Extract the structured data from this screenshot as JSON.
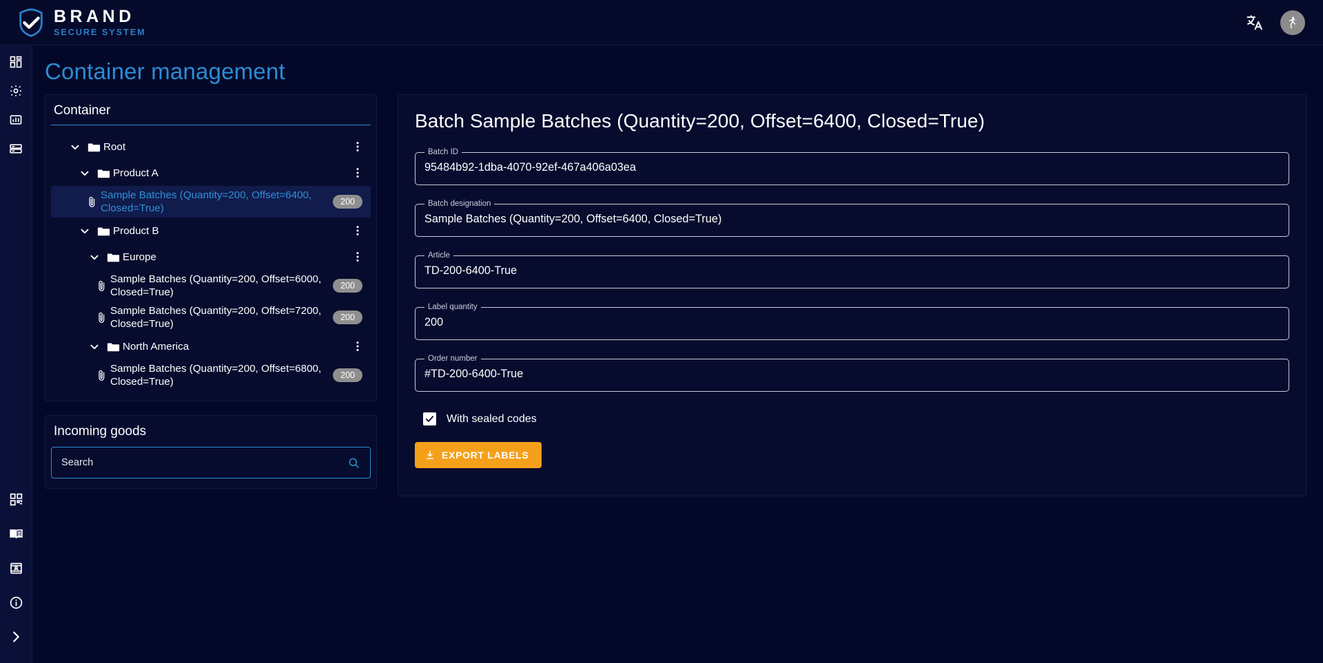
{
  "header": {
    "logo_brand": "BRAND",
    "logo_sub": "SECURE SYSTEM",
    "logo_icon": "shield-check-icon",
    "translate_icon": "translate-icon",
    "accessibility_icon": "accessibility-icon"
  },
  "rail": {
    "top_items": [
      {
        "name": "dashboard-icon",
        "label": "Dashboard"
      },
      {
        "name": "gear-icon",
        "label": "Settings"
      },
      {
        "name": "chart-icon",
        "label": "Reports"
      },
      {
        "name": "container-icon",
        "label": "Containers"
      }
    ],
    "bottom_items": [
      {
        "name": "qr-code-icon",
        "label": "Codes"
      },
      {
        "name": "book-icon",
        "label": "Manual"
      },
      {
        "name": "contact-card-icon",
        "label": "Contact"
      },
      {
        "name": "info-icon",
        "label": "Info"
      },
      {
        "name": "chevron-right-icon",
        "label": "Expand menu"
      }
    ]
  },
  "page": {
    "title": "Container management"
  },
  "container_panel": {
    "heading": "Container",
    "tree": [
      {
        "type": "folder",
        "label": "Root",
        "indent": 0,
        "expanded": true,
        "menu": true,
        "selected": false,
        "badge": null
      },
      {
        "type": "folder",
        "label": "Product A",
        "indent": 1,
        "expanded": true,
        "menu": true,
        "selected": false,
        "badge": null
      },
      {
        "type": "batch",
        "label": "Sample Batches (Quantity=200, Offset=6400, Closed=True)",
        "indent": 2,
        "expanded": false,
        "menu": false,
        "selected": true,
        "badge": "200"
      },
      {
        "type": "folder",
        "label": "Product B",
        "indent": 1,
        "expanded": true,
        "menu": true,
        "selected": false,
        "badge": null
      },
      {
        "type": "folder",
        "label": "Europe",
        "indent": 2,
        "expanded": true,
        "menu": true,
        "selected": false,
        "badge": null
      },
      {
        "type": "batch",
        "label": "Sample Batches (Quantity=200, Offset=6000, Closed=True)",
        "indent": 3,
        "expanded": false,
        "menu": false,
        "selected": false,
        "badge": "200"
      },
      {
        "type": "batch",
        "label": "Sample Batches (Quantity=200, Offset=7200, Closed=True)",
        "indent": 3,
        "expanded": false,
        "menu": false,
        "selected": false,
        "badge": "200"
      },
      {
        "type": "folder",
        "label": "North America",
        "indent": 2,
        "expanded": true,
        "menu": true,
        "selected": false,
        "badge": null
      },
      {
        "type": "batch",
        "label": "Sample Batches (Quantity=200, Offset=6800, Closed=True)",
        "indent": 3,
        "expanded": false,
        "menu": false,
        "selected": false,
        "badge": "200"
      }
    ]
  },
  "incoming_panel": {
    "heading": "Incoming goods",
    "search_placeholder": "Search",
    "search_value": "",
    "search_icon": "search-icon"
  },
  "detail": {
    "title": "Batch Sample Batches (Quantity=200, Offset=6400, Closed=True)",
    "fields": [
      {
        "label": "Batch ID",
        "value": "95484b92-1dba-4070-92ef-467a406a03ea",
        "name": "batch-id-field"
      },
      {
        "label": "Batch designation",
        "value": "Sample Batches (Quantity=200, Offset=6400, Closed=True)",
        "name": "batch-designation-field"
      },
      {
        "label": "Article",
        "value": "TD-200-6400-True",
        "name": "article-field"
      },
      {
        "label": "Label quantity",
        "value": "200",
        "name": "label-quantity-field"
      },
      {
        "label": "Order number",
        "value": "#TD-200-6400-True",
        "name": "order-number-field"
      }
    ],
    "checkbox_label": "With sealed codes",
    "checkbox_checked": true,
    "export_label": "EXPORT LABELS",
    "export_icon": "download-icon"
  },
  "colors": {
    "background": "#040828",
    "panel": "#070c2e",
    "accent_blue": "#2b8cd4",
    "accent_orange": "#f5a01b",
    "badge_gray": "#8f8f8f",
    "selected_row": "#111b4c"
  }
}
